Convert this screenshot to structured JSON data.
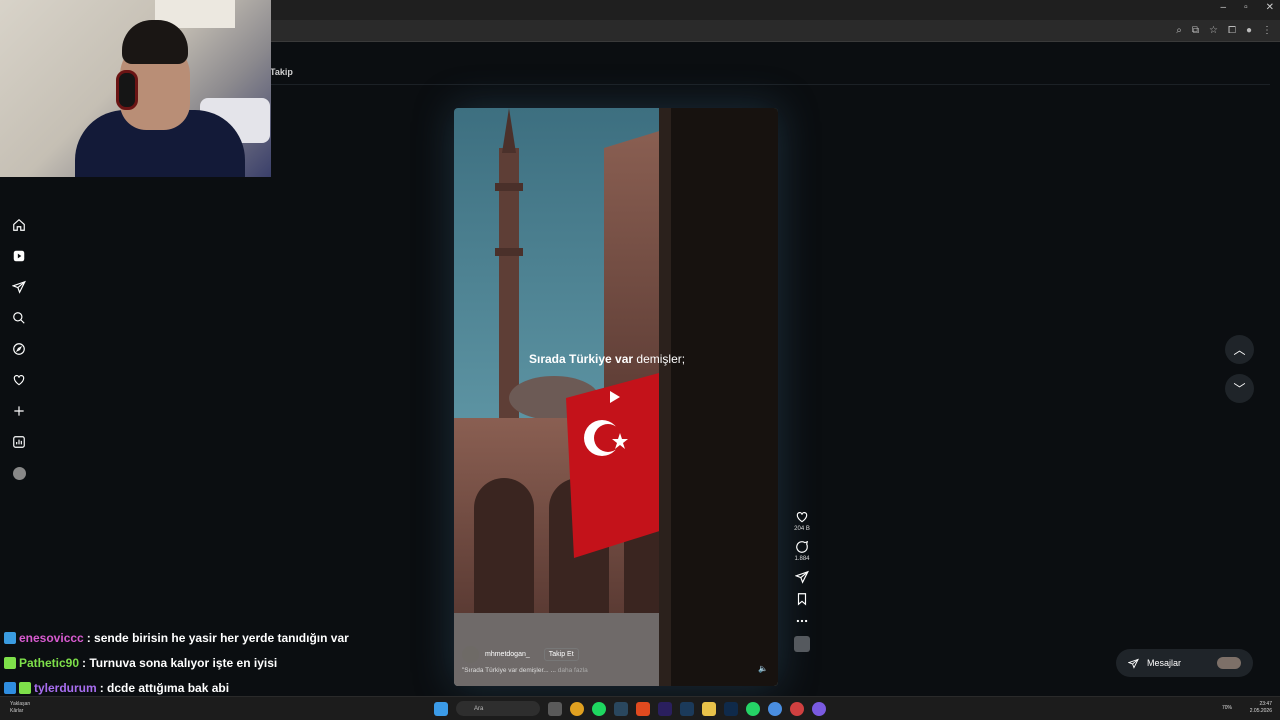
{
  "browser": {
    "window_controls": [
      "–",
      "▫",
      "✕"
    ],
    "addr_icons": [
      "search-icon",
      "install-icon",
      "star-icon",
      "extensions-icon",
      "profile-icon",
      "menu-icon"
    ]
  },
  "header": {
    "following_tab": "Takip"
  },
  "sidebar": {
    "items": [
      {
        "icon": "home-icon"
      },
      {
        "icon": "reels-icon"
      },
      {
        "icon": "send-icon"
      },
      {
        "icon": "search-icon"
      },
      {
        "icon": "explore-icon"
      },
      {
        "icon": "heart-icon"
      },
      {
        "icon": "plus-icon"
      },
      {
        "icon": "dashboard-icon"
      },
      {
        "icon": "profile-avatar"
      }
    ]
  },
  "video": {
    "caption_bold": "Sırada Türkiye var",
    "caption_rest": " demişler;",
    "username": "mhmetdogan_",
    "follow_label": "Takip Et",
    "description": "\"Sırada Türkiye var demişler... ...",
    "more_label": " daha fazla"
  },
  "actions": {
    "likes": "204 B",
    "comments": "1.884"
  },
  "messages": {
    "label": "Mesajlar"
  },
  "chat": [
    {
      "user": "enesoviccc",
      "text": " : sende birisin he yasir her yerde tanıdığın var",
      "color": "#d85bd0",
      "badge": "#3a9be0"
    },
    {
      "user": "Pathetic90",
      "text": " : Turnuva sona kalıyor işte en iyisi",
      "color": "#7ee04a",
      "badge": "#7ee04a"
    },
    {
      "user": "tylerdurum",
      "text": " : dcde attığıma bak abi",
      "color": "#a86ef0",
      "badge": "#2f8de0"
    }
  ],
  "taskbar": {
    "weather_line1": "Yaklaşan",
    "weather_line2": "Kârlar",
    "search_label": "Ara",
    "battery": "70%",
    "time": "23:47",
    "date": "2.05.2026"
  }
}
